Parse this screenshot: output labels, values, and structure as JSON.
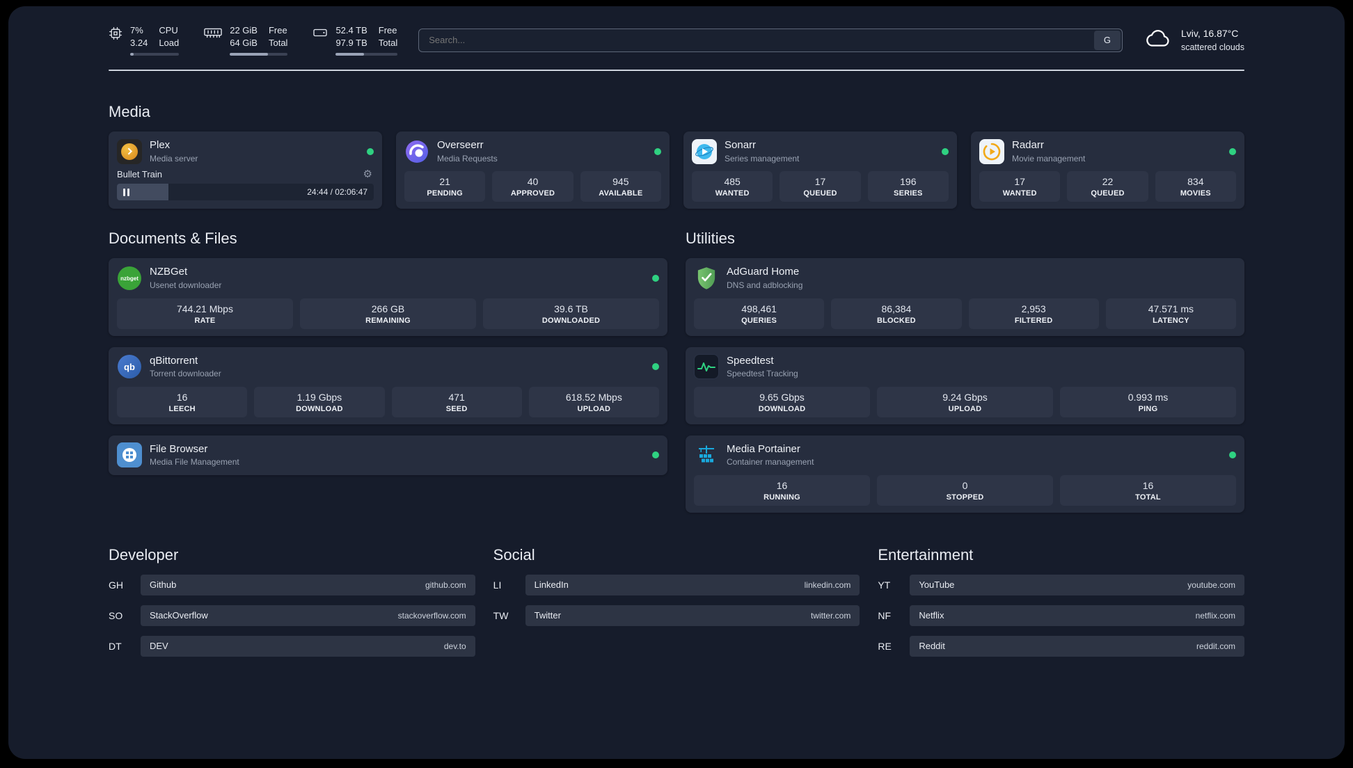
{
  "colors": {
    "status-green": "#2fd181",
    "page-bg": "#161c2b",
    "card-bg": "#262d3e",
    "tile-bg": "#2e3547"
  },
  "topbar": {
    "cpu": {
      "percent": 7,
      "value_top": "7%",
      "value_bottom": "3.24",
      "label_top": "CPU",
      "label_bottom": "Load"
    },
    "ram": {
      "percent": 66,
      "value_top": "22 GiB",
      "value_bottom": "64 GiB",
      "label_top": "Free",
      "label_bottom": "Total"
    },
    "disk": {
      "percent": 46,
      "value_top": "52.4 TB",
      "value_bottom": "97.9 TB",
      "label_top": "Free",
      "label_bottom": "Total"
    },
    "search": {
      "placeholder": "Search...",
      "button_label": "G"
    },
    "weather": {
      "location": "Lviv, 16.87°C",
      "condition": "scattered clouds"
    }
  },
  "media": {
    "title": "Media",
    "plex": {
      "name": "Plex",
      "desc": "Media server",
      "track_title": "Bullet Train",
      "time": "24:44 / 02:06:47",
      "progress_percent": 20
    },
    "overseerr": {
      "name": "Overseerr",
      "desc": "Media Requests",
      "stats": [
        {
          "value": "21",
          "label": "PENDING"
        },
        {
          "value": "40",
          "label": "APPROVED"
        },
        {
          "value": "945",
          "label": "AVAILABLE"
        }
      ]
    },
    "sonarr": {
      "name": "Sonarr",
      "desc": "Series management",
      "stats": [
        {
          "value": "485",
          "label": "WANTED"
        },
        {
          "value": "17",
          "label": "QUEUED"
        },
        {
          "value": "196",
          "label": "SERIES"
        }
      ]
    },
    "radarr": {
      "name": "Radarr",
      "desc": "Movie management",
      "stats": [
        {
          "value": "17",
          "label": "WANTED"
        },
        {
          "value": "22",
          "label": "QUEUED"
        },
        {
          "value": "834",
          "label": "MOVIES"
        }
      ]
    }
  },
  "documents": {
    "title": "Documents & Files",
    "nzbget": {
      "name": "NZBGet",
      "desc": "Usenet downloader",
      "stats": [
        {
          "value": "744.21 Mbps",
          "label": "RATE"
        },
        {
          "value": "266 GB",
          "label": "REMAINING"
        },
        {
          "value": "39.6 TB",
          "label": "DOWNLOADED"
        }
      ]
    },
    "qbittorrent": {
      "name": "qBittorrent",
      "desc": "Torrent downloader",
      "stats": [
        {
          "value": "16",
          "label": "LEECH"
        },
        {
          "value": "1.19 Gbps",
          "label": "DOWNLOAD"
        },
        {
          "value": "471",
          "label": "SEED"
        },
        {
          "value": "618.52 Mbps",
          "label": "UPLOAD"
        }
      ]
    },
    "filebrowser": {
      "name": "File Browser",
      "desc": "Media File Management"
    }
  },
  "utilities": {
    "title": "Utilities",
    "adguard": {
      "name": "AdGuard Home",
      "desc": "DNS and adblocking",
      "stats": [
        {
          "value": "498,461",
          "label": "QUERIES"
        },
        {
          "value": "86,384",
          "label": "BLOCKED"
        },
        {
          "value": "2,953",
          "label": "FILTERED"
        },
        {
          "value": "47.571 ms",
          "label": "LATENCY"
        }
      ]
    },
    "speedtest": {
      "name": "Speedtest",
      "desc": "Speedtest Tracking",
      "stats": [
        {
          "value": "9.65 Gbps",
          "label": "DOWNLOAD"
        },
        {
          "value": "9.24 Gbps",
          "label": "UPLOAD"
        },
        {
          "value": "0.993 ms",
          "label": "PING"
        }
      ]
    },
    "portainer": {
      "name": "Media Portainer",
      "desc": "Container management",
      "stats": [
        {
          "value": "16",
          "label": "RUNNING"
        },
        {
          "value": "0",
          "label": "STOPPED"
        },
        {
          "value": "16",
          "label": "TOTAL"
        }
      ]
    }
  },
  "links": {
    "developer": {
      "title": "Developer",
      "items": [
        {
          "abbr": "GH",
          "name": "Github",
          "url": "github.com"
        },
        {
          "abbr": "SO",
          "name": "StackOverflow",
          "url": "stackoverflow.com"
        },
        {
          "abbr": "DT",
          "name": "DEV",
          "url": "dev.to"
        }
      ]
    },
    "social": {
      "title": "Social",
      "items": [
        {
          "abbr": "LI",
          "name": "LinkedIn",
          "url": "linkedin.com"
        },
        {
          "abbr": "TW",
          "name": "Twitter",
          "url": "twitter.com"
        }
      ]
    },
    "entertainment": {
      "title": "Entertainment",
      "items": [
        {
          "abbr": "YT",
          "name": "YouTube",
          "url": "youtube.com"
        },
        {
          "abbr": "NF",
          "name": "Netflix",
          "url": "netflix.com"
        },
        {
          "abbr": "RE",
          "name": "Reddit",
          "url": "reddit.com"
        }
      ]
    }
  }
}
